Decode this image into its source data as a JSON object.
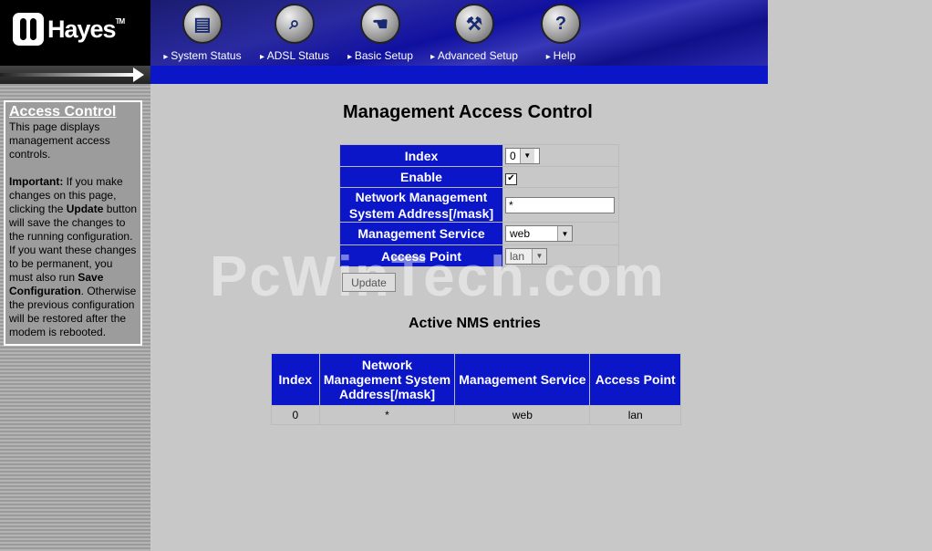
{
  "brand": {
    "name": "Hayes",
    "tm": "TM"
  },
  "nav": [
    {
      "label": "System Status",
      "icon": "document-icon"
    },
    {
      "label": "ADSL Status",
      "icon": "magnifier-icon"
    },
    {
      "label": "Basic Setup",
      "icon": "hand-icon"
    },
    {
      "label": "Advanced Setup",
      "icon": "wrench-icon"
    },
    {
      "label": "Help",
      "icon": "question-icon"
    }
  ],
  "sidebar": {
    "title": "Access Control",
    "description": "This page displays management access controls.",
    "important_label": "Important:",
    "text1": " If you make changes on this page, clicking the ",
    "update_word": "Update",
    "text2": " button will save the changes to the running configuration. If you want these changes to be permanent, you must also run ",
    "save_word": "Save Configuration",
    "text3": ". Otherwise the previous configuration will be restored after the modem is rebooted."
  },
  "main": {
    "title": "Management Access Control",
    "form": {
      "index_label": "Index",
      "index_value": "0",
      "enable_label": "Enable",
      "enable_checked": "✔",
      "address_label": "Network Management System Address[/mask]",
      "address_value": "*",
      "service_label": "Management Service",
      "service_value": "web",
      "access_label": "Access Point",
      "access_value": "lan"
    },
    "update_button": "Update",
    "watermark": "PcWinTech.com",
    "nms_title": "Active NMS entries",
    "nms_headers": [
      "Index",
      "Network Management System Address[/mask]",
      "Management Service",
      "Access Point"
    ],
    "nms_rows": [
      [
        "0",
        "*",
        "web",
        "lan"
      ]
    ]
  },
  "colors": {
    "accent": "#0a16c8",
    "background": "#c8c8c8"
  }
}
